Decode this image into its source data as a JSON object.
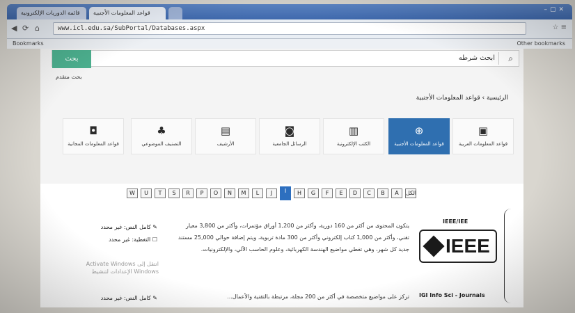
{
  "browser": {
    "tabs": [
      {
        "label": "قائمة الدوريات الإلكترونية"
      },
      {
        "label": "قواعد المعلومات الأجنبية"
      },
      {
        "label": ""
      }
    ],
    "url": "www.icl.edu.sa/SubPortal/Databases.aspx",
    "bookmarks_label": "Bookmarks",
    "other_bookmarks": "Other bookmarks"
  },
  "search": {
    "button_label": "بحث",
    "placeholder": "ابحث شرطه",
    "advanced_label": "بحث متقدم"
  },
  "breadcrumb": "الرئيسية › قواعد المعلومات الأجنبية",
  "categories": [
    {
      "label": "قواعد المعلومات العربية",
      "icon": "database-icon"
    },
    {
      "label": "قواعد المعلومات الأجنبية",
      "icon": "globe-icon",
      "active": true
    },
    {
      "label": "الكتب الإلكترونية",
      "icon": "book-icon"
    },
    {
      "label": "الرسائل الجامعية",
      "icon": "thesis-icon"
    },
    {
      "label": "الأرشيف",
      "icon": "archive-icon"
    },
    {
      "label": "التصنيف الموضوعي",
      "icon": "sitemap-icon"
    },
    {
      "label": "قواعد المعلومات المجانية",
      "icon": "free-db-icon"
    }
  ],
  "alphabet": [
    "الكل",
    "A",
    "B",
    "C",
    "D",
    "E",
    "F",
    "G",
    "H",
    "I",
    "J",
    "L",
    "M",
    "N",
    "O",
    "P",
    "R",
    "S",
    "T",
    "U",
    "W"
  ],
  "alphabet_active": "I",
  "entries": [
    {
      "title": "IEEE/IEE",
      "logo_text": "IEEE",
      "description": "يتكون المحتوى من أكثر من 160 دورية، وأكثر من 1,200 أوراق مؤتمرات، وأكثر من 3,800 معيار تقني، وأكثر من 1,000 كتاب إلكتروني وأكثر من 300 مادة تربوية، ويتم إضافة حوالي 25,000 مستند جديد كل شهر، وهي تغطي مواضيع الهندسة الكهربائية، وعلوم الحاسب الآلي، والإلكترونيات.",
      "fulltext_label": "كامل النص: غير محدد",
      "coverage_label": "التغطية: غير محدد"
    },
    {
      "title": "IGI Info Sci - Journals",
      "description": "تركز على مواضيع متخصصة في أكثر من 200 مجلة، مرتبطة بالتقنية والأعمال...",
      "fulltext_label": "كامل النص: غير محدد"
    }
  ],
  "windows_watermark": "Activate Windows\nانتقل إلى الإعدادات لتنشيط Windows"
}
